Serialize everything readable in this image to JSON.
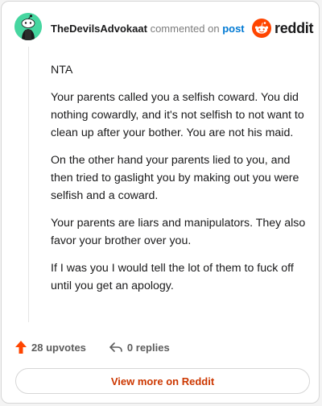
{
  "comment": {
    "username": "TheDevilsAdvokaat",
    "meta_text": "commented on",
    "post_link": "post",
    "paragraphs": [
      "NTA",
      "Your parents called you a selfish coward. You did nothing cowardly, and it's not selfish to not want to clean up after your bother. You are not his maid.",
      "On the other hand your parents lied to you, and then tried to gaslight you by making out you were selfish and a coward.",
      "Your parents are liars and manipulators. They also favor your brother over you.",
      "If I was you I would tell the lot of them to fuck off until you get an apology."
    ]
  },
  "brand": {
    "name": "reddit",
    "icon": "reddit-snoo-icon",
    "color": "#ff4500"
  },
  "actions": {
    "upvotes_label": "28 upvotes",
    "upvote_icon": "upvote-arrow-icon",
    "replies_label": "0 replies",
    "reply_icon": "reply-arrow-icon"
  },
  "footer": {
    "view_more_label": "View more on Reddit"
  },
  "colors": {
    "accent": "#ff4500",
    "link": "#0079d3",
    "view_more_text": "#cc3700",
    "avatar_bg": "#46d6a0"
  }
}
